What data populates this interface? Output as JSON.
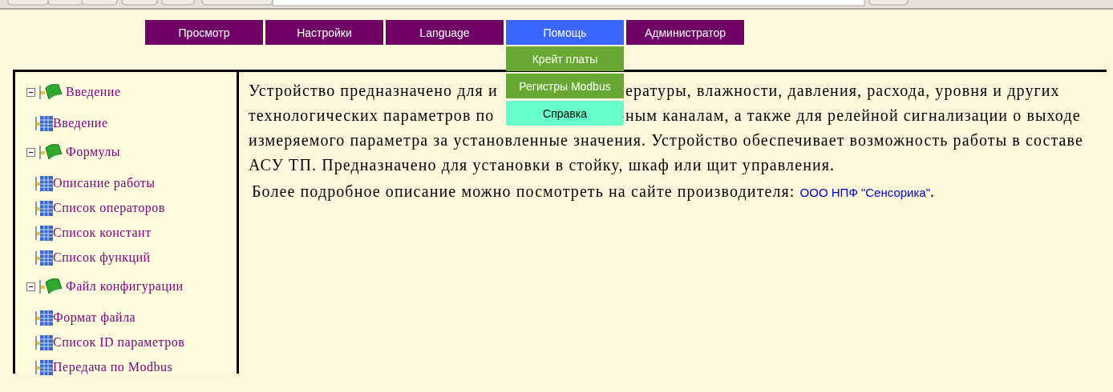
{
  "menu": [
    {
      "label": "Просмотр",
      "selected": false
    },
    {
      "label": "Настройки",
      "selected": false
    },
    {
      "label": "Language",
      "selected": false
    },
    {
      "label": "Помощь",
      "selected": true,
      "dropdown": [
        {
          "label": "Крейт платы",
          "hovered": false
        },
        {
          "label": "Регистры Modbus",
          "hovered": false
        },
        {
          "label": "Справка",
          "hovered": true
        }
      ]
    },
    {
      "label": "Администратор",
      "selected": false
    }
  ],
  "tree": [
    {
      "label": "Введение",
      "expanded": true,
      "children": [
        {
          "label": "Введение"
        }
      ]
    },
    {
      "label": "Формулы",
      "expanded": true,
      "children": [
        {
          "label": "Описание работы"
        },
        {
          "label": "Список операторов"
        },
        {
          "label": "Список констант"
        },
        {
          "label": "Список функций"
        }
      ]
    },
    {
      "label": "Файл конфигурации",
      "expanded": true,
      "children": [
        {
          "label": "Формат файла"
        },
        {
          "label": "Список ID параметров"
        },
        {
          "label": "Передача по Modbus"
        }
      ]
    }
  ],
  "content": {
    "description_lines": [
      [
        "Устройство предназначено для и",
        "ературы, влажности, давления, расхода, уровня и других"
      ],
      [
        "технологических параметров по ",
        "ным каналам, а также для релейной сигнализации о выходе"
      ],
      [
        "измеряемого параметра за установленные значения. Устройство обеспечивает возможность работы в составе"
      ],
      [
        "АСУ ТП. Предназначено для установки в стойку, шкаф или щит управления."
      ]
    ],
    "more_info": {
      "text": "Более подробное описание можно посмотреть на сайте производителя: ",
      "link": "ООО НПФ \"Сенсорика\"",
      "after": "."
    }
  }
}
